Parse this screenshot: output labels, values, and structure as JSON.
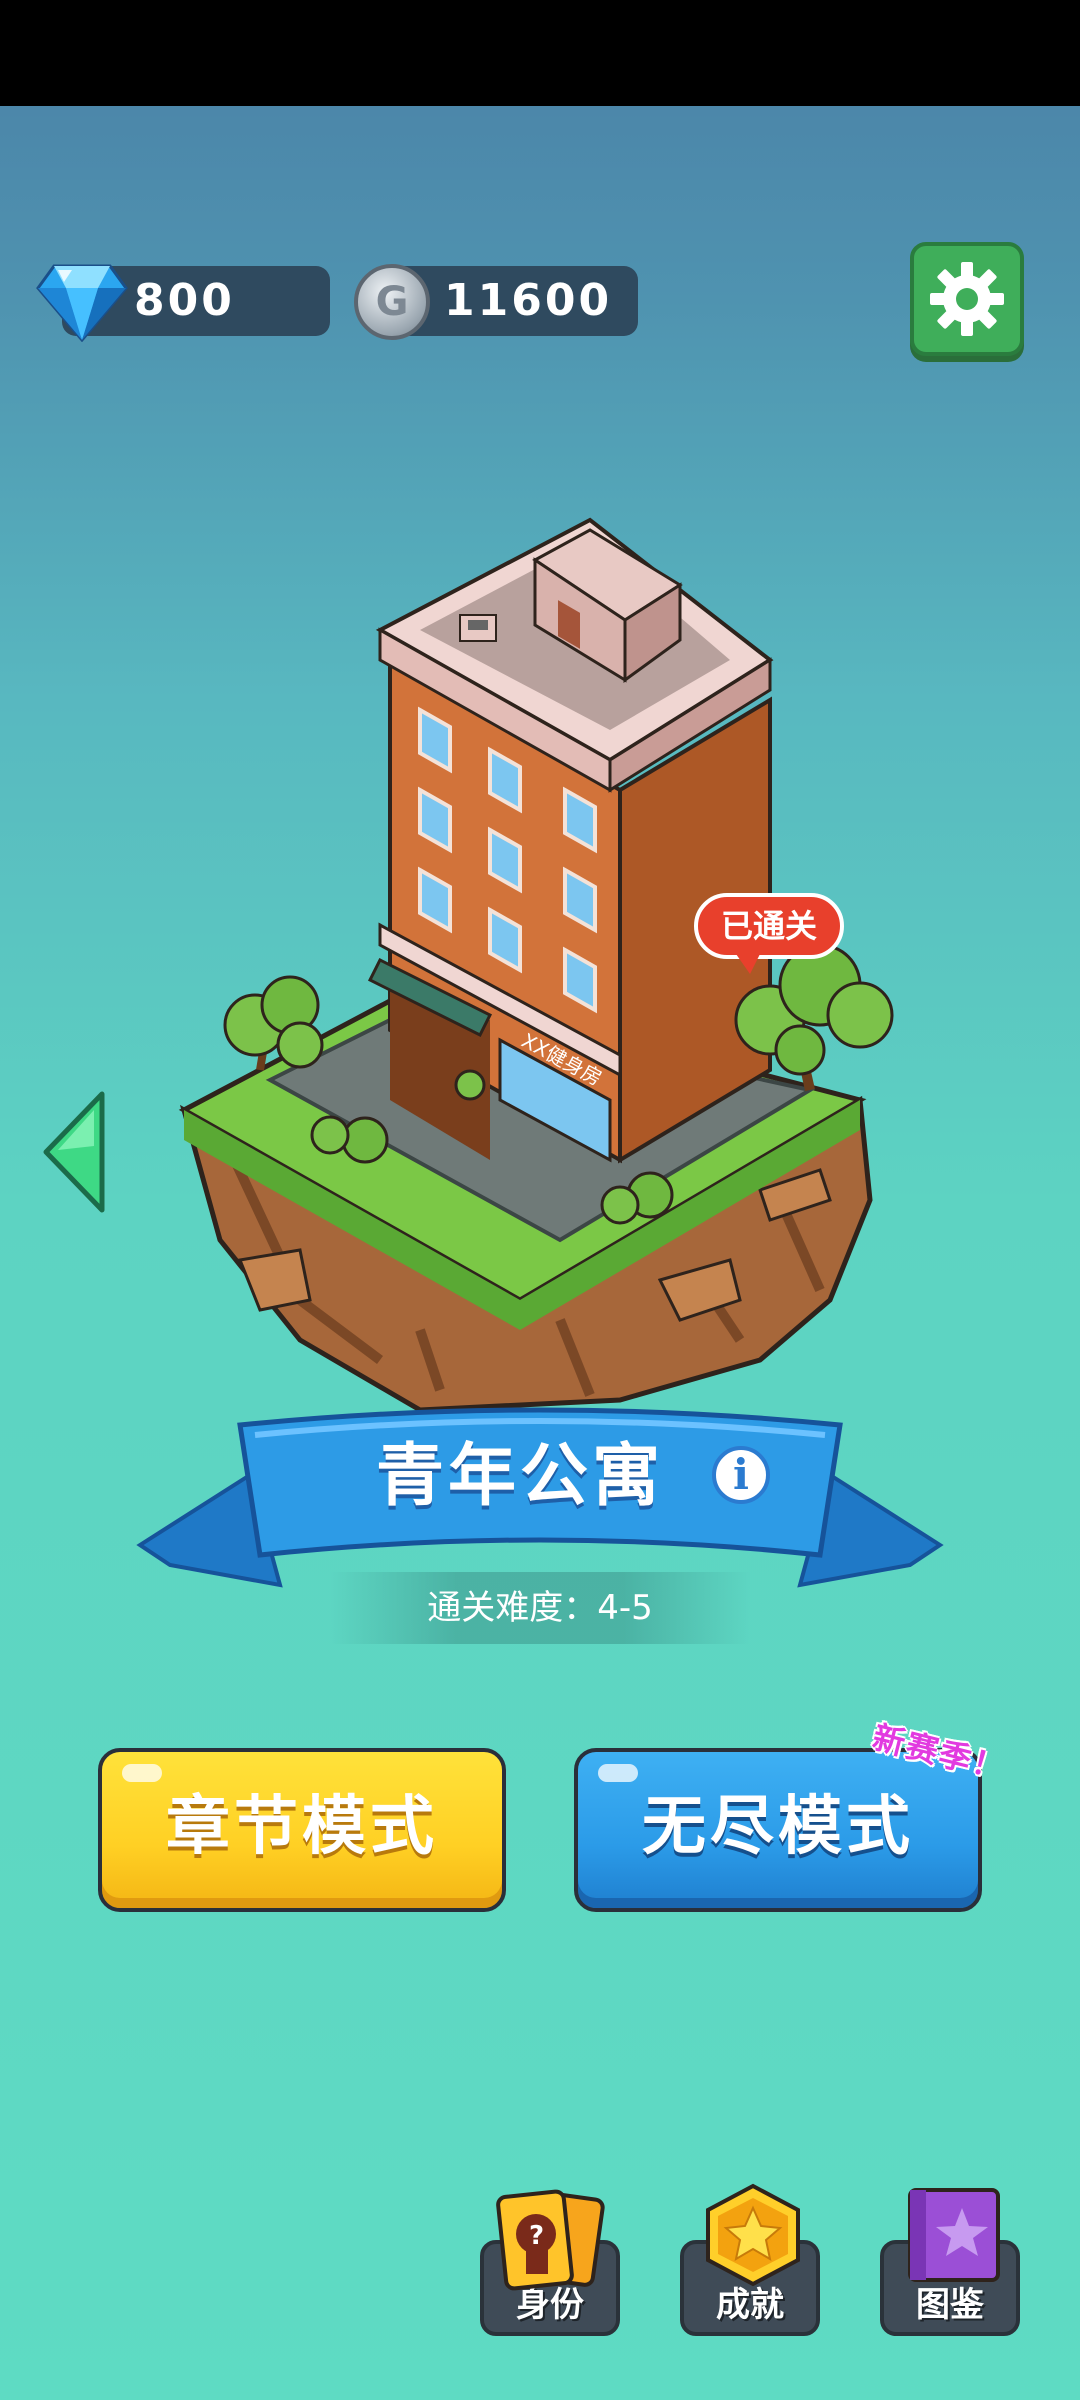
{
  "currency": {
    "gems": "800",
    "coins": "11600",
    "coin_symbol": "G"
  },
  "island": {
    "building_sign": "XX健身房",
    "status_badge": "已通关"
  },
  "level": {
    "title": "青年公寓",
    "info_symbol": "i",
    "difficulty": "通关难度：4-5"
  },
  "modes": {
    "chapter_label": "章节模式",
    "endless_label": "无尽模式",
    "endless_tag": "新赛季！"
  },
  "bottom_nav": [
    {
      "label": "身份",
      "icon": "identity-card-icon"
    },
    {
      "label": "成就",
      "icon": "star-badge-icon"
    },
    {
      "label": "图鉴",
      "icon": "book-icon"
    }
  ],
  "colors": {
    "chapter_button": "#ffd024",
    "endless_button": "#2b9be8",
    "settings_button": "#3fae5a",
    "status_badge": "#e8402c"
  }
}
